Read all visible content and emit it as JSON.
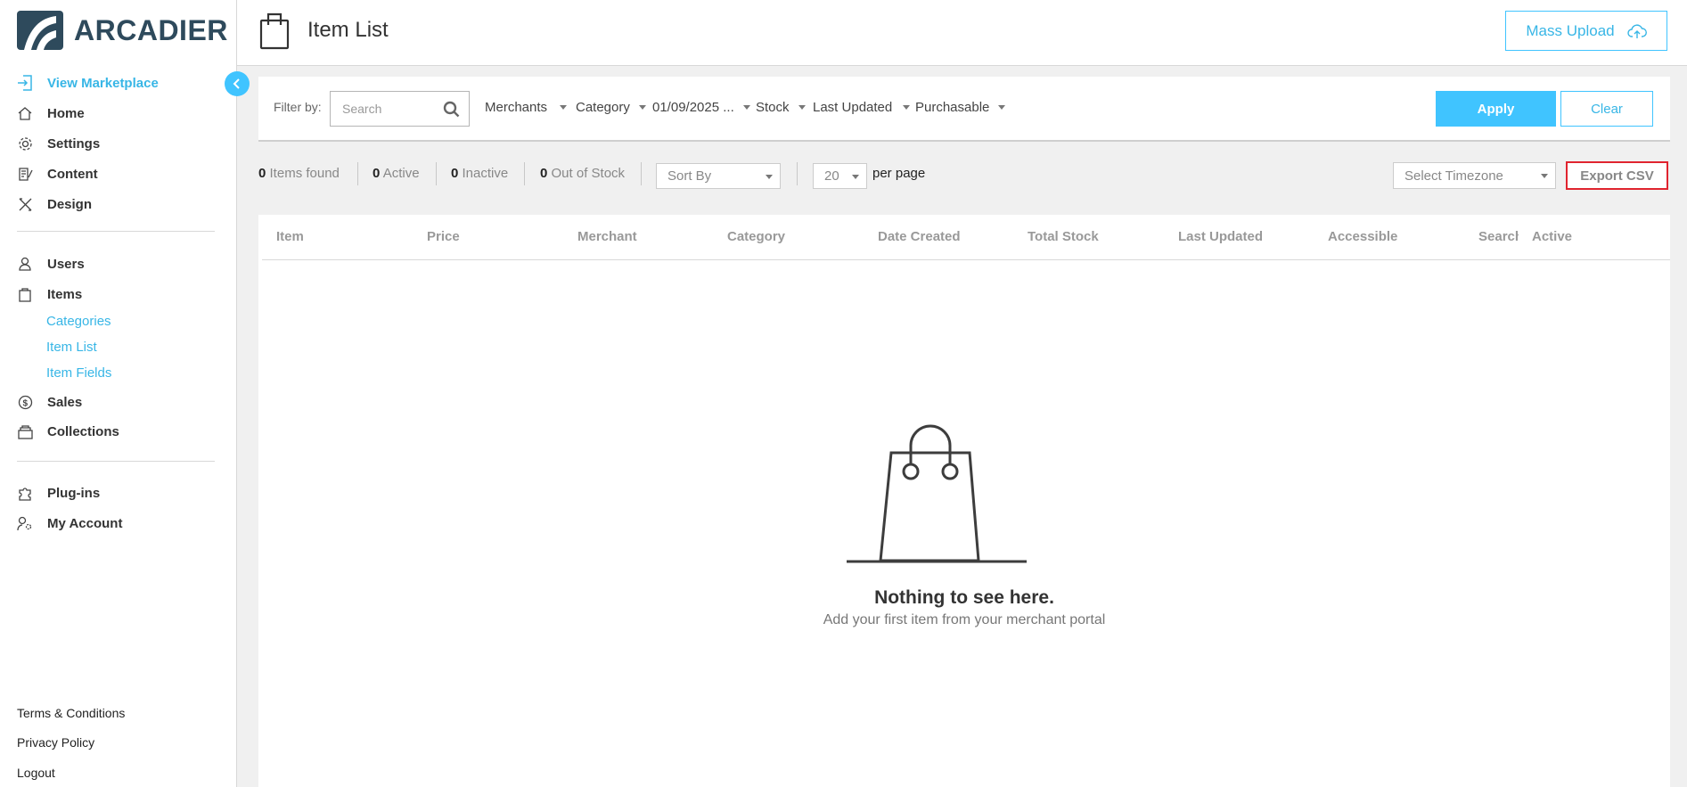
{
  "brand": {
    "name": "ARCADIER",
    "accent": "#40c4ff",
    "logo_color": "#2e4a5c"
  },
  "sidebar": {
    "view_marketplace": "View Marketplace",
    "items": [
      {
        "label": "Home",
        "icon": "home-icon"
      },
      {
        "label": "Settings",
        "icon": "gear-icon"
      },
      {
        "label": "Content",
        "icon": "content-edit-icon"
      },
      {
        "label": "Design",
        "icon": "design-tools-icon"
      }
    ],
    "items2": [
      {
        "label": "Users",
        "icon": "user-icon"
      },
      {
        "label": "Items",
        "icon": "bag-icon"
      }
    ],
    "sub_items": [
      "Categories",
      "Item List",
      "Item Fields"
    ],
    "items3": [
      {
        "label": "Sales",
        "icon": "dollar-icon"
      },
      {
        "label": "Collections",
        "icon": "collections-icon"
      }
    ],
    "items4": [
      {
        "label": "Plug-ins",
        "icon": "puzzle-icon"
      },
      {
        "label": "My Account",
        "icon": "account-settings-icon"
      }
    ],
    "footer": [
      "Terms & Conditions",
      "Privacy Policy",
      "Logout"
    ]
  },
  "header": {
    "title": "Item List",
    "mass_upload": "Mass Upload"
  },
  "filters": {
    "label": "Filter by:",
    "search_placeholder": "Search",
    "dropdowns": [
      "Merchants",
      "Category",
      "01/09/2025 ...",
      "Stock",
      "Last Updated",
      "Purchasable"
    ],
    "apply": "Apply",
    "clear": "Clear"
  },
  "stats": {
    "found_count": "0",
    "found_label": "Items found",
    "active_count": "0",
    "active_label": "Active",
    "inactive_count": "0",
    "inactive_label": "Inactive",
    "oos_count": "0",
    "oos_label": "Out of Stock"
  },
  "controls": {
    "sort_by": "Sort By",
    "page_size": "20",
    "per_page": "per page",
    "timezone": "Select Timezone",
    "export_csv": "Export CSV"
  },
  "table": {
    "columns": [
      "Item",
      "Price",
      "Merchant",
      "Category",
      "Date Created",
      "Total Stock",
      "Last Updated",
      "Accessible",
      "Search",
      "Active"
    ]
  },
  "empty_state": {
    "title": "Nothing to see here.",
    "subtitle": "Add your first item from your merchant portal"
  }
}
